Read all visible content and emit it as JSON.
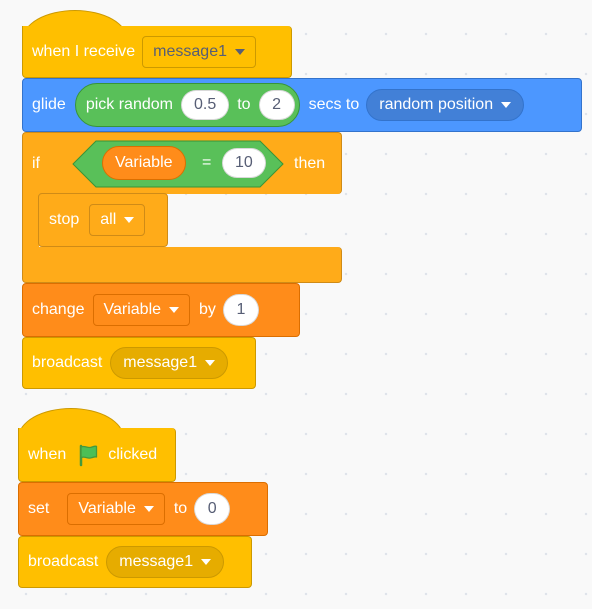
{
  "script1": {
    "hat": {
      "label": "when I receive",
      "message": "message1"
    },
    "glide": {
      "label": "glide",
      "pick_random": "pick random",
      "from": "0.5",
      "to_label": "to",
      "to": "2",
      "secs_to": "secs to",
      "target": "random position"
    },
    "if_block": {
      "label": "if",
      "variable": "Variable",
      "operator": "=",
      "value": "10",
      "then_label": "then"
    },
    "stop": {
      "label": "stop",
      "option": "all"
    },
    "change": {
      "label": "change",
      "variable": "Variable",
      "by_label": "by",
      "value": "1"
    },
    "broadcast": {
      "label": "broadcast",
      "message": "message1"
    }
  },
  "script2": {
    "hat": {
      "label_when": "when",
      "label_clicked": "clicked",
      "icon": "green-flag-icon"
    },
    "set": {
      "label": "set",
      "variable": "Variable",
      "to_label": "to",
      "value": "0"
    },
    "broadcast": {
      "label": "broadcast",
      "message": "message1"
    }
  },
  "colors": {
    "events": "#ffbf00",
    "motion": "#4c97ff",
    "control": "#ffab19",
    "variables": "#ff8c1a",
    "operators": "#59c059"
  }
}
